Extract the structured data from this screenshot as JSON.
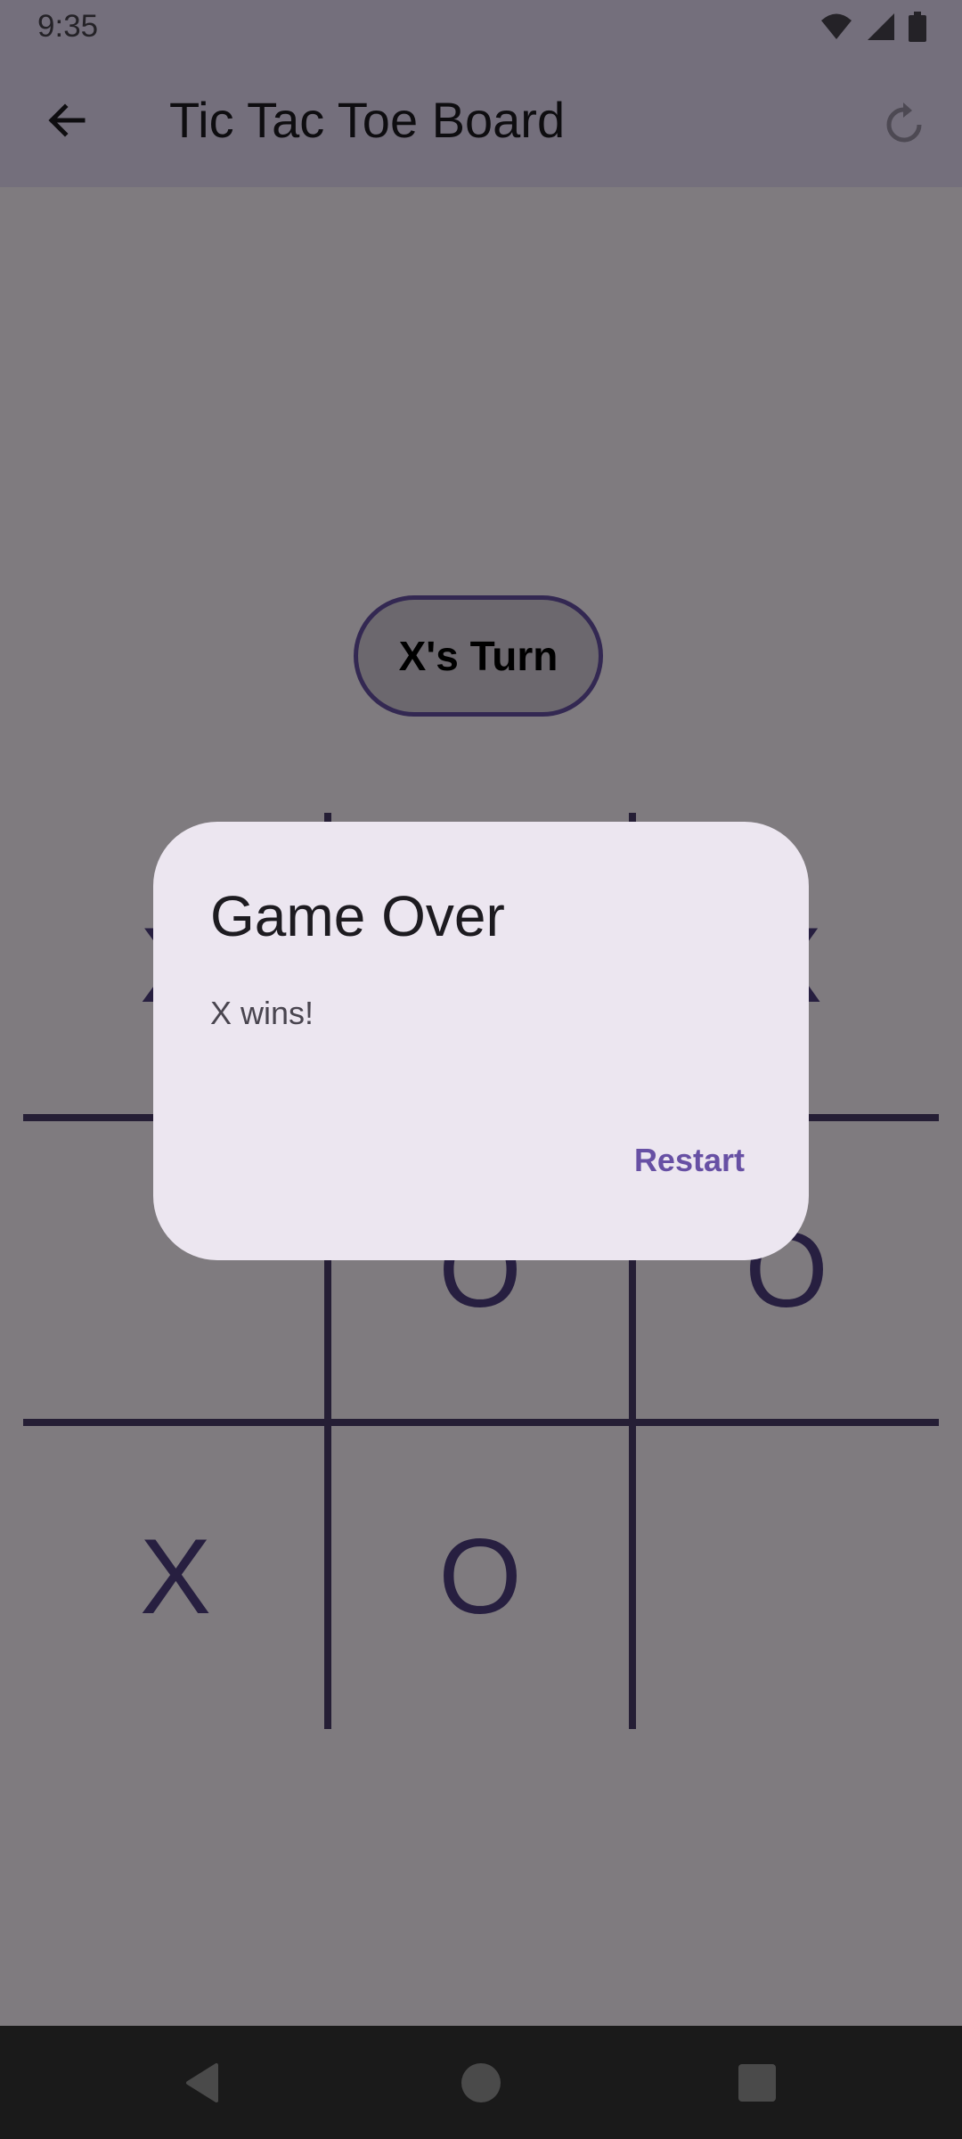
{
  "status_bar": {
    "time": "9:35"
  },
  "app_bar": {
    "title": "Tic Tac Toe Board"
  },
  "turn_indicator": {
    "label": "X's Turn"
  },
  "board": {
    "cells": [
      "X",
      "",
      "X",
      "",
      "O",
      "O",
      "X",
      "O",
      ""
    ]
  },
  "dialog": {
    "title": "Game Over",
    "message": "X wins!",
    "action_label": "Restart"
  },
  "colors": {
    "app_bar": "#e8def8",
    "accent": "#6750a4",
    "mark": "#4f3f80",
    "dialog_bg": "#ece6f0"
  },
  "icons": {
    "status": [
      "wifi-icon",
      "cellular-signal-icon",
      "battery-icon"
    ],
    "app_bar": [
      "back-arrow-icon",
      "refresh-icon"
    ],
    "nav": [
      "nav-back-icon",
      "nav-home-icon",
      "nav-recents-icon"
    ]
  }
}
